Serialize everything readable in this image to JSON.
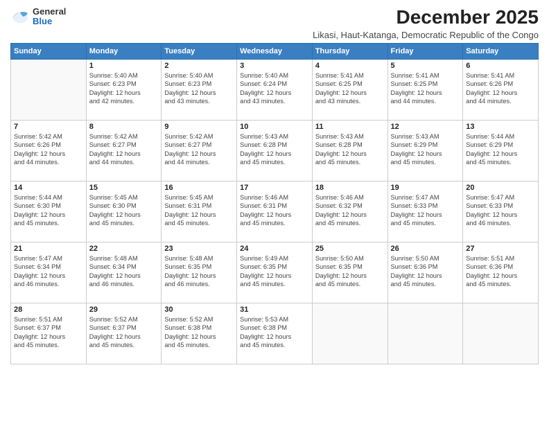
{
  "logo": {
    "general": "General",
    "blue": "Blue"
  },
  "title": "December 2025",
  "subtitle": "Likasi, Haut-Katanga, Democratic Republic of the Congo",
  "days_of_week": [
    "Sunday",
    "Monday",
    "Tuesday",
    "Wednesday",
    "Thursday",
    "Friday",
    "Saturday"
  ],
  "weeks": [
    [
      {
        "day": "",
        "info": ""
      },
      {
        "day": "1",
        "info": "Sunrise: 5:40 AM\nSunset: 6:23 PM\nDaylight: 12 hours\nand 42 minutes."
      },
      {
        "day": "2",
        "info": "Sunrise: 5:40 AM\nSunset: 6:23 PM\nDaylight: 12 hours\nand 43 minutes."
      },
      {
        "day": "3",
        "info": "Sunrise: 5:40 AM\nSunset: 6:24 PM\nDaylight: 12 hours\nand 43 minutes."
      },
      {
        "day": "4",
        "info": "Sunrise: 5:41 AM\nSunset: 6:25 PM\nDaylight: 12 hours\nand 43 minutes."
      },
      {
        "day": "5",
        "info": "Sunrise: 5:41 AM\nSunset: 6:25 PM\nDaylight: 12 hours\nand 44 minutes."
      },
      {
        "day": "6",
        "info": "Sunrise: 5:41 AM\nSunset: 6:26 PM\nDaylight: 12 hours\nand 44 minutes."
      }
    ],
    [
      {
        "day": "7",
        "info": "Sunrise: 5:42 AM\nSunset: 6:26 PM\nDaylight: 12 hours\nand 44 minutes."
      },
      {
        "day": "8",
        "info": "Sunrise: 5:42 AM\nSunset: 6:27 PM\nDaylight: 12 hours\nand 44 minutes."
      },
      {
        "day": "9",
        "info": "Sunrise: 5:42 AM\nSunset: 6:27 PM\nDaylight: 12 hours\nand 44 minutes."
      },
      {
        "day": "10",
        "info": "Sunrise: 5:43 AM\nSunset: 6:28 PM\nDaylight: 12 hours\nand 45 minutes."
      },
      {
        "day": "11",
        "info": "Sunrise: 5:43 AM\nSunset: 6:28 PM\nDaylight: 12 hours\nand 45 minutes."
      },
      {
        "day": "12",
        "info": "Sunrise: 5:43 AM\nSunset: 6:29 PM\nDaylight: 12 hours\nand 45 minutes."
      },
      {
        "day": "13",
        "info": "Sunrise: 5:44 AM\nSunset: 6:29 PM\nDaylight: 12 hours\nand 45 minutes."
      }
    ],
    [
      {
        "day": "14",
        "info": "Sunrise: 5:44 AM\nSunset: 6:30 PM\nDaylight: 12 hours\nand 45 minutes."
      },
      {
        "day": "15",
        "info": "Sunrise: 5:45 AM\nSunset: 6:30 PM\nDaylight: 12 hours\nand 45 minutes."
      },
      {
        "day": "16",
        "info": "Sunrise: 5:45 AM\nSunset: 6:31 PM\nDaylight: 12 hours\nand 45 minutes."
      },
      {
        "day": "17",
        "info": "Sunrise: 5:46 AM\nSunset: 6:31 PM\nDaylight: 12 hours\nand 45 minutes."
      },
      {
        "day": "18",
        "info": "Sunrise: 5:46 AM\nSunset: 6:32 PM\nDaylight: 12 hours\nand 45 minutes."
      },
      {
        "day": "19",
        "info": "Sunrise: 5:47 AM\nSunset: 6:33 PM\nDaylight: 12 hours\nand 45 minutes."
      },
      {
        "day": "20",
        "info": "Sunrise: 5:47 AM\nSunset: 6:33 PM\nDaylight: 12 hours\nand 46 minutes."
      }
    ],
    [
      {
        "day": "21",
        "info": "Sunrise: 5:47 AM\nSunset: 6:34 PM\nDaylight: 12 hours\nand 46 minutes."
      },
      {
        "day": "22",
        "info": "Sunrise: 5:48 AM\nSunset: 6:34 PM\nDaylight: 12 hours\nand 46 minutes."
      },
      {
        "day": "23",
        "info": "Sunrise: 5:48 AM\nSunset: 6:35 PM\nDaylight: 12 hours\nand 46 minutes."
      },
      {
        "day": "24",
        "info": "Sunrise: 5:49 AM\nSunset: 6:35 PM\nDaylight: 12 hours\nand 45 minutes."
      },
      {
        "day": "25",
        "info": "Sunrise: 5:50 AM\nSunset: 6:35 PM\nDaylight: 12 hours\nand 45 minutes."
      },
      {
        "day": "26",
        "info": "Sunrise: 5:50 AM\nSunset: 6:36 PM\nDaylight: 12 hours\nand 45 minutes."
      },
      {
        "day": "27",
        "info": "Sunrise: 5:51 AM\nSunset: 6:36 PM\nDaylight: 12 hours\nand 45 minutes."
      }
    ],
    [
      {
        "day": "28",
        "info": "Sunrise: 5:51 AM\nSunset: 6:37 PM\nDaylight: 12 hours\nand 45 minutes."
      },
      {
        "day": "29",
        "info": "Sunrise: 5:52 AM\nSunset: 6:37 PM\nDaylight: 12 hours\nand 45 minutes."
      },
      {
        "day": "30",
        "info": "Sunrise: 5:52 AM\nSunset: 6:38 PM\nDaylight: 12 hours\nand 45 minutes."
      },
      {
        "day": "31",
        "info": "Sunrise: 5:53 AM\nSunset: 6:38 PM\nDaylight: 12 hours\nand 45 minutes."
      },
      {
        "day": "",
        "info": ""
      },
      {
        "day": "",
        "info": ""
      },
      {
        "day": "",
        "info": ""
      }
    ]
  ]
}
